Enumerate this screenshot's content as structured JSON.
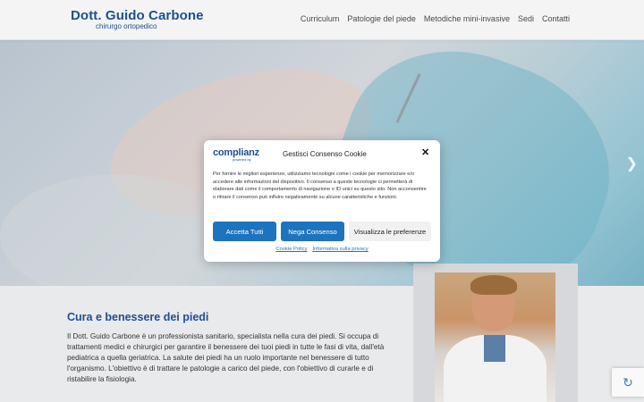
{
  "header": {
    "logo_name": "Dott. Guido Carbone",
    "logo_sub": "chirurgo ortopedico",
    "nav": [
      "Curriculum",
      "Patologie del piede",
      "Metodiche mini-invasive",
      "Sedi",
      "Contatti"
    ]
  },
  "hero": {
    "next_icon": "chevron-right-icon"
  },
  "content": {
    "title": "Cura e benessere dei piedi",
    "text": "Il Dott. Guido Carbone è un professionista sanitario, specialista nella cura dei piedi. Si occupa di trattamenti medici e chirurgici per garantire il benessere dei tuoi piedi in tutte le fasi di vita, dall'età pediatrica a quella geriatrica. La salute dei piedi ha un ruolo importante nel benessere di tutto l'organismo. L'obiettivo è di trattare le patologie a carico del piede, con l'obiettivo di curarle e di ristabilire la fisiologia."
  },
  "consent": {
    "brand_name": "complianz",
    "brand_sub": "powered by",
    "title": "Gestisci Consenso Cookie",
    "close_icon": "close-icon",
    "text": "Per fornire le migliori esperienze, utilizziamo tecnologie come i cookie per memorizzare e/o accedere alle informazioni del dispositivo. Il consenso a queste tecnologie ci permetterà di elaborare dati come il comportamento di navigazione o ID unici su questo sito. Non acconsentire o ritirare il consenso può influire negativamente su alcune caratteristiche e funzioni.",
    "accept_label": "Accetta Tutti",
    "deny_label": "Nega Consenso",
    "prefs_label": "Visualizza le preferenze",
    "cookie_policy_link": "Cookie Policy",
    "privacy_link": "Informativa sulla privacy"
  },
  "colors": {
    "brand_blue": "#1e4f8f",
    "button_blue": "#1e73be"
  }
}
